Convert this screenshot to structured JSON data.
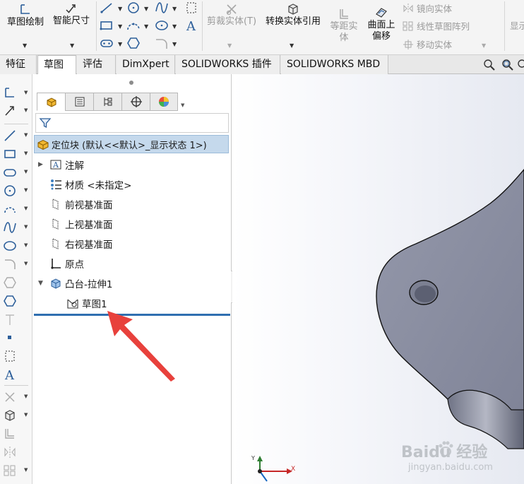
{
  "ribbon": {
    "sketch": "草图绘制",
    "smart_dim": "智能尺寸",
    "trim": "剪裁实体(T)",
    "convert": "转换实体引用",
    "offset_line1": "等距实",
    "offset_line2": "体",
    "surface_line1": "曲面上",
    "surface_line2": "偏移",
    "mirror": "镜向实体",
    "linear_pattern": "线性草图阵列",
    "move": "移动实体",
    "display_partial": "显示"
  },
  "tabs": [
    {
      "label": "特征"
    },
    {
      "label": "草图"
    },
    {
      "label": "评估"
    },
    {
      "label": "DimXpert"
    },
    {
      "label": "SOLIDWORKS 插件"
    },
    {
      "label": "SOLIDWORKS MBD"
    }
  ],
  "feature_tree": {
    "root": "定位块 (默认<<默认>_显示状态 1>)",
    "items": [
      {
        "label": "注解"
      },
      {
        "label": "材质 <未指定>"
      },
      {
        "label": "前视基准面"
      },
      {
        "label": "上视基准面"
      },
      {
        "label": "右视基准面"
      },
      {
        "label": "原点"
      },
      {
        "label": "凸台-拉伸1"
      },
      {
        "label": "草图1"
      }
    ]
  },
  "triad": {
    "x_label": "X",
    "y_label": "Y"
  },
  "watermark": {
    "brand": "Baidu 经验",
    "url": "jingyan.baidu.com"
  },
  "colors": {
    "highlight": "#c5d9ec",
    "rollback": "#2f6fb0",
    "part_face": "#8a8ea0",
    "arrow": "#e8413c"
  }
}
